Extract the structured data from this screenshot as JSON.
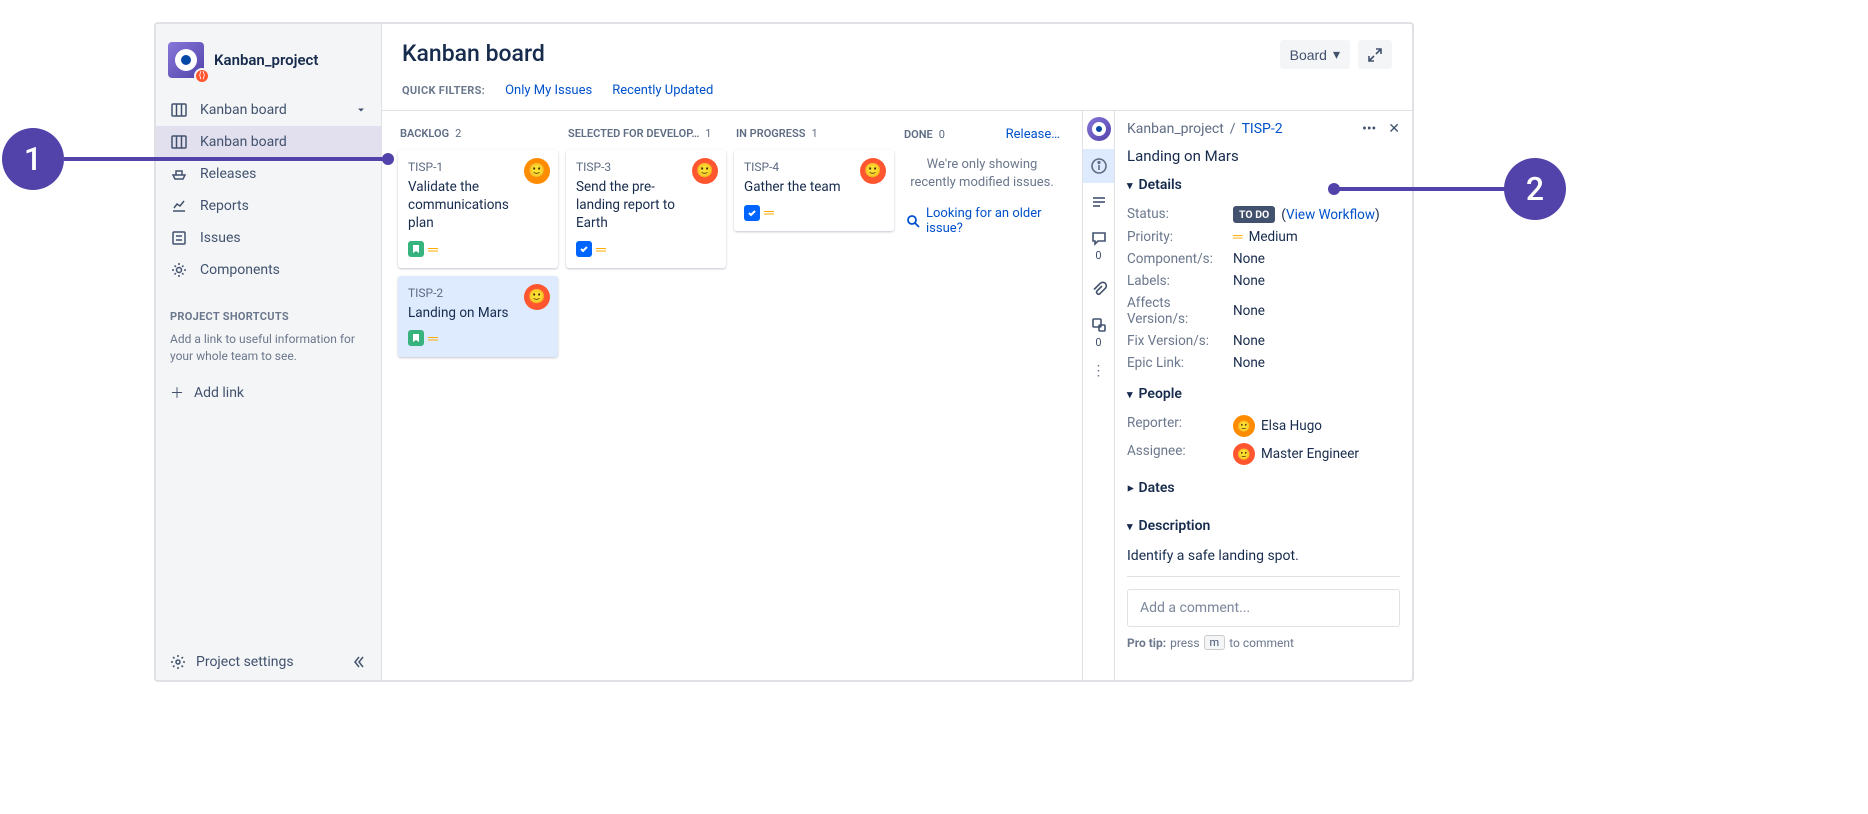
{
  "project": {
    "name": "Kanban_project"
  },
  "sidebar": {
    "parent": "Kanban board",
    "items": [
      {
        "label": "Kanban board"
      },
      {
        "label": "Releases"
      },
      {
        "label": "Reports"
      },
      {
        "label": "Issues"
      },
      {
        "label": "Components"
      }
    ],
    "shortcuts_title": "PROJECT SHORTCUTS",
    "shortcuts_desc": "Add a link to useful information for your whole team to see.",
    "add_link": "Add link",
    "settings": "Project settings"
  },
  "header": {
    "title": "Kanban board",
    "board_button": "Board",
    "quick_filters_label": "QUICK FILTERS:",
    "filters": [
      "Only My Issues",
      "Recently Updated"
    ]
  },
  "columns": [
    {
      "name": "BACKLOG",
      "count": "2",
      "cards": [
        {
          "key": "TISP-1",
          "title": "Validate the communications plan",
          "type": "story",
          "avatar": "orange"
        },
        {
          "key": "TISP-2",
          "title": "Landing on Mars",
          "type": "story",
          "avatar": "red",
          "selected": true
        }
      ]
    },
    {
      "name": "SELECTED FOR DEVELOP…",
      "count": "1",
      "cards": [
        {
          "key": "TISP-3",
          "title": "Send the pre-landing report to Earth",
          "type": "task",
          "avatar": "red"
        }
      ]
    },
    {
      "name": "IN PROGRESS",
      "count": "1",
      "cards": [
        {
          "key": "TISP-4",
          "title": "Gather the team",
          "type": "task",
          "avatar": "red"
        }
      ]
    },
    {
      "name": "DONE",
      "count": "0",
      "release_link": "Release…",
      "empty_msg": "We're only showing recently modified issues.",
      "empty_link": "Looking for an older issue?"
    }
  ],
  "rail": {
    "comments_count": "0",
    "subtasks_count": "0"
  },
  "detail": {
    "project": "Kanban_project",
    "key": "TISP-2",
    "title": "Landing on Mars",
    "sections": {
      "details": "Details",
      "people": "People",
      "dates": "Dates",
      "description": "Description"
    },
    "fields": {
      "status_label": "Status:",
      "status_value": "TO DO",
      "workflow": "View Workflow",
      "priority_label": "Priority:",
      "priority_value": "Medium",
      "components_label": "Component/s:",
      "components_value": "None",
      "labels_label": "Labels:",
      "labels_value": "None",
      "affects_label": "Affects Version/s:",
      "affects_value": "None",
      "fix_label": "Fix Version/s:",
      "fix_value": "None",
      "epic_label": "Epic Link:",
      "epic_value": "None",
      "reporter_label": "Reporter:",
      "reporter_value": "Elsa Hugo",
      "assignee_label": "Assignee:",
      "assignee_value": "Master Engineer"
    },
    "description_text": "Identify a safe landing spot.",
    "comment_placeholder": "Add a comment...",
    "pro_tip_prefix": "Pro tip:",
    "pro_tip_press": "press",
    "pro_tip_key": "m",
    "pro_tip_suffix": "to comment"
  },
  "callouts": {
    "one": "1",
    "two": "2"
  }
}
